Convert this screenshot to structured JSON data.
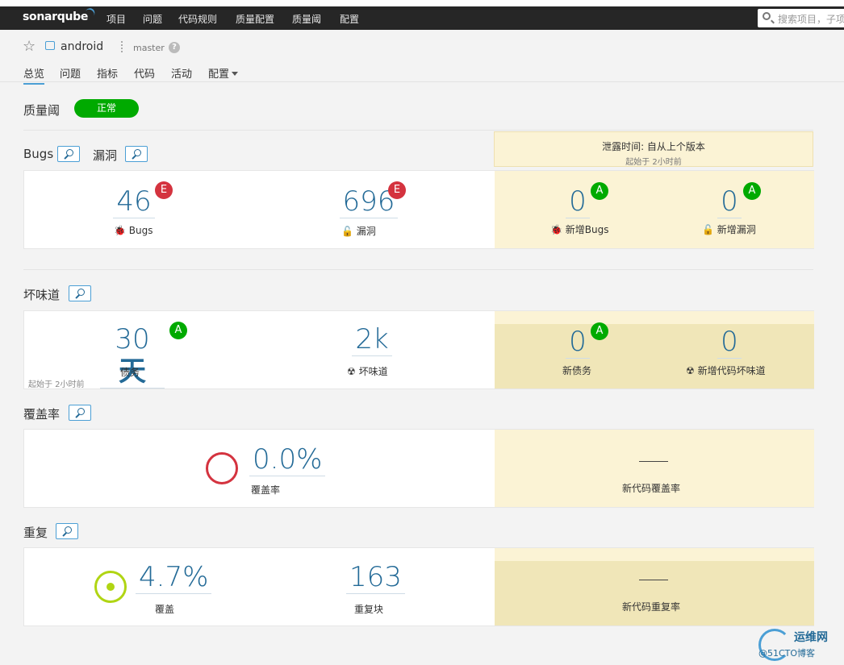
{
  "navbar": {
    "logo": "sonarqube",
    "items": [
      "项目",
      "问题",
      "代码规则",
      "质量配置",
      "质量阈",
      "配置"
    ],
    "search_placeholder": "搜索项目，子项目"
  },
  "project": {
    "name": "android",
    "branch": "master",
    "help": "?",
    "tabs": [
      "总览",
      "问题",
      "指标",
      "代码",
      "活动",
      "配置"
    ]
  },
  "quality_gate": {
    "label": "质量阈",
    "status": "正常",
    "status_color": "#00aa00"
  },
  "leak": {
    "title": "泄露时间: 自从上个版本",
    "subtitle": "起始于 2小时前"
  },
  "bugs_section": {
    "title_bugs": "Bugs",
    "title_vulns": "漏洞",
    "bugs": {
      "value": "46",
      "rating": "E",
      "label": "Bugs"
    },
    "vulns": {
      "value": "696",
      "rating": "E",
      "label": "漏洞"
    },
    "new_bugs": {
      "value": "0",
      "rating": "A",
      "label": "新增Bugs"
    },
    "new_vulns": {
      "value": "0",
      "rating": "A",
      "label": "新增漏洞"
    }
  },
  "smells_section": {
    "title": "坏味道",
    "debt": {
      "value_num": "30",
      "value_unit": "天",
      "rating": "A",
      "label": "债务"
    },
    "since": "起始于 2小时前",
    "smells": {
      "value": "2k",
      "label": "坏味道"
    },
    "new_debt": {
      "value": "0",
      "rating": "A",
      "label": "新债务"
    },
    "new_smells": {
      "value": "0",
      "label": "新增代码坏味道"
    }
  },
  "coverage_section": {
    "title": "覆盖率",
    "coverage": {
      "value": "0.0%",
      "label": "覆盖率"
    },
    "new_coverage": {
      "value": "—",
      "label": "新代码覆盖率"
    }
  },
  "dup_section": {
    "title": "重复",
    "duplications": {
      "value": "4.7%",
      "label": "覆盖"
    },
    "blocks": {
      "value": "163",
      "label": "重复块"
    },
    "new_dup": {
      "value": "—",
      "label": "新代码重复率"
    }
  },
  "watermark": {
    "line1": "运维网",
    "line2": "@51CTO博客"
  }
}
